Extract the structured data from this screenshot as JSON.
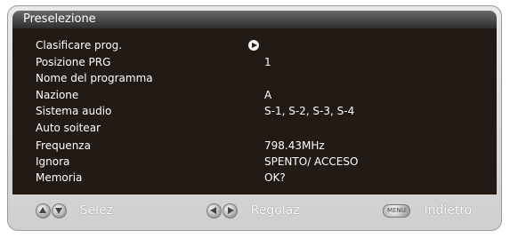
{
  "title": "Preselezione",
  "rows": [
    {
      "label": "Clasificare prog.",
      "value": ""
    },
    {
      "label": "Posizione PRG",
      "value": "1"
    },
    {
      "label": "Nome del programma",
      "value": ""
    },
    {
      "label": "Nazione",
      "value": "A"
    },
    {
      "label": "Sistema audio",
      "value": "S-1, S-2, S-3, S-4"
    },
    {
      "label": "Auto soitear",
      "value": ""
    },
    {
      "label": "Frequenza",
      "value": "798.43MHz"
    },
    {
      "label": "Ignora",
      "value": "SPENTO/ ACCESO"
    },
    {
      "label": "Memoria",
      "value": "OK?"
    }
  ],
  "footer": {
    "select_label": ": Selez",
    "adjust_label": ": Regolaz",
    "menu_key": "MENU",
    "back_label": ": Indietro"
  },
  "icons": {
    "row_arrow": "play-arrow-icon",
    "select": "up-down-arrows-icon",
    "adjust": "left-right-arrows-icon",
    "menu": "menu-button-icon"
  },
  "colors": {
    "panel_bg": "#221a14",
    "text": "#ffffff",
    "title_bar": "#3a3a3a",
    "frame": "#d9d9d9"
  }
}
